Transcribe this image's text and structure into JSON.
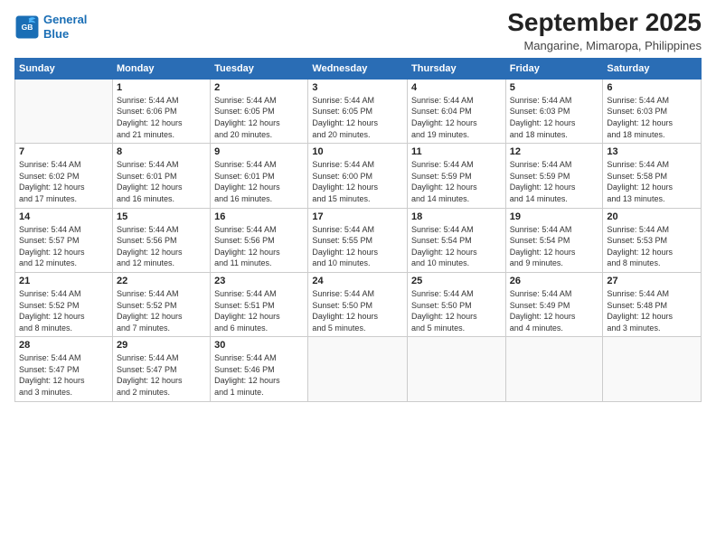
{
  "logo": {
    "line1": "General",
    "line2": "Blue"
  },
  "title": "September 2025",
  "subtitle": "Mangarine, Mimaropa, Philippines",
  "weekdays": [
    "Sunday",
    "Monday",
    "Tuesday",
    "Wednesday",
    "Thursday",
    "Friday",
    "Saturday"
  ],
  "weeks": [
    [
      {
        "day": "",
        "info": ""
      },
      {
        "day": "1",
        "info": "Sunrise: 5:44 AM\nSunset: 6:06 PM\nDaylight: 12 hours\nand 21 minutes."
      },
      {
        "day": "2",
        "info": "Sunrise: 5:44 AM\nSunset: 6:05 PM\nDaylight: 12 hours\nand 20 minutes."
      },
      {
        "day": "3",
        "info": "Sunrise: 5:44 AM\nSunset: 6:05 PM\nDaylight: 12 hours\nand 20 minutes."
      },
      {
        "day": "4",
        "info": "Sunrise: 5:44 AM\nSunset: 6:04 PM\nDaylight: 12 hours\nand 19 minutes."
      },
      {
        "day": "5",
        "info": "Sunrise: 5:44 AM\nSunset: 6:03 PM\nDaylight: 12 hours\nand 18 minutes."
      },
      {
        "day": "6",
        "info": "Sunrise: 5:44 AM\nSunset: 6:03 PM\nDaylight: 12 hours\nand 18 minutes."
      }
    ],
    [
      {
        "day": "7",
        "info": "Sunrise: 5:44 AM\nSunset: 6:02 PM\nDaylight: 12 hours\nand 17 minutes."
      },
      {
        "day": "8",
        "info": "Sunrise: 5:44 AM\nSunset: 6:01 PM\nDaylight: 12 hours\nand 16 minutes."
      },
      {
        "day": "9",
        "info": "Sunrise: 5:44 AM\nSunset: 6:01 PM\nDaylight: 12 hours\nand 16 minutes."
      },
      {
        "day": "10",
        "info": "Sunrise: 5:44 AM\nSunset: 6:00 PM\nDaylight: 12 hours\nand 15 minutes."
      },
      {
        "day": "11",
        "info": "Sunrise: 5:44 AM\nSunset: 5:59 PM\nDaylight: 12 hours\nand 14 minutes."
      },
      {
        "day": "12",
        "info": "Sunrise: 5:44 AM\nSunset: 5:59 PM\nDaylight: 12 hours\nand 14 minutes."
      },
      {
        "day": "13",
        "info": "Sunrise: 5:44 AM\nSunset: 5:58 PM\nDaylight: 12 hours\nand 13 minutes."
      }
    ],
    [
      {
        "day": "14",
        "info": "Sunrise: 5:44 AM\nSunset: 5:57 PM\nDaylight: 12 hours\nand 12 minutes."
      },
      {
        "day": "15",
        "info": "Sunrise: 5:44 AM\nSunset: 5:56 PM\nDaylight: 12 hours\nand 12 minutes."
      },
      {
        "day": "16",
        "info": "Sunrise: 5:44 AM\nSunset: 5:56 PM\nDaylight: 12 hours\nand 11 minutes."
      },
      {
        "day": "17",
        "info": "Sunrise: 5:44 AM\nSunset: 5:55 PM\nDaylight: 12 hours\nand 10 minutes."
      },
      {
        "day": "18",
        "info": "Sunrise: 5:44 AM\nSunset: 5:54 PM\nDaylight: 12 hours\nand 10 minutes."
      },
      {
        "day": "19",
        "info": "Sunrise: 5:44 AM\nSunset: 5:54 PM\nDaylight: 12 hours\nand 9 minutes."
      },
      {
        "day": "20",
        "info": "Sunrise: 5:44 AM\nSunset: 5:53 PM\nDaylight: 12 hours\nand 8 minutes."
      }
    ],
    [
      {
        "day": "21",
        "info": "Sunrise: 5:44 AM\nSunset: 5:52 PM\nDaylight: 12 hours\nand 8 minutes."
      },
      {
        "day": "22",
        "info": "Sunrise: 5:44 AM\nSunset: 5:52 PM\nDaylight: 12 hours\nand 7 minutes."
      },
      {
        "day": "23",
        "info": "Sunrise: 5:44 AM\nSunset: 5:51 PM\nDaylight: 12 hours\nand 6 minutes."
      },
      {
        "day": "24",
        "info": "Sunrise: 5:44 AM\nSunset: 5:50 PM\nDaylight: 12 hours\nand 5 minutes."
      },
      {
        "day": "25",
        "info": "Sunrise: 5:44 AM\nSunset: 5:50 PM\nDaylight: 12 hours\nand 5 minutes."
      },
      {
        "day": "26",
        "info": "Sunrise: 5:44 AM\nSunset: 5:49 PM\nDaylight: 12 hours\nand 4 minutes."
      },
      {
        "day": "27",
        "info": "Sunrise: 5:44 AM\nSunset: 5:48 PM\nDaylight: 12 hours\nand 3 minutes."
      }
    ],
    [
      {
        "day": "28",
        "info": "Sunrise: 5:44 AM\nSunset: 5:47 PM\nDaylight: 12 hours\nand 3 minutes."
      },
      {
        "day": "29",
        "info": "Sunrise: 5:44 AM\nSunset: 5:47 PM\nDaylight: 12 hours\nand 2 minutes."
      },
      {
        "day": "30",
        "info": "Sunrise: 5:44 AM\nSunset: 5:46 PM\nDaylight: 12 hours\nand 1 minute."
      },
      {
        "day": "",
        "info": ""
      },
      {
        "day": "",
        "info": ""
      },
      {
        "day": "",
        "info": ""
      },
      {
        "day": "",
        "info": ""
      }
    ]
  ]
}
